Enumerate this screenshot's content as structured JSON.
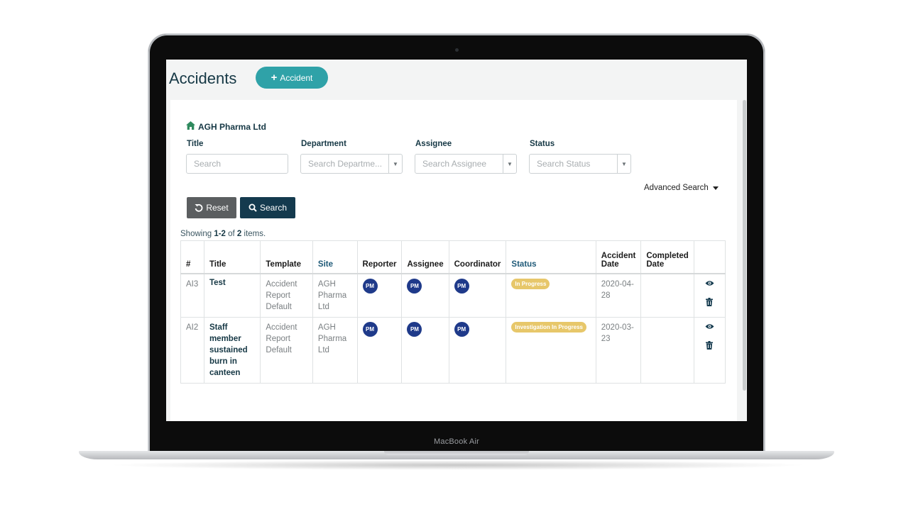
{
  "device": {
    "label": "MacBook Air"
  },
  "page": {
    "title": "Accidents",
    "add_button": "Accident"
  },
  "filters": {
    "company": "AGH Pharma Ltd",
    "title_label": "Title",
    "title_placeholder": "Search",
    "department_label": "Department",
    "department_placeholder": "Search Departme...",
    "assignee_label": "Assignee",
    "assignee_placeholder": "Search Assignee",
    "status_label": "Status",
    "status_placeholder": "Search Status",
    "advanced_search": "Advanced Search",
    "reset": "Reset",
    "search": "Search"
  },
  "summary": {
    "prefix": "Showing ",
    "range": "1-2",
    "of": " of ",
    "total": "2",
    "suffix": " items."
  },
  "table": {
    "headers": {
      "num": "#",
      "title": "Title",
      "template": "Template",
      "site": "Site",
      "reporter": "Reporter",
      "assignee": "Assignee",
      "coordinator": "Coordinator",
      "status": "Status",
      "accident_date": "Accident Date",
      "completed_date": "Completed Date"
    },
    "rows": [
      {
        "id": "AI3",
        "title": "Test",
        "template": "Accident Report Default",
        "site": "AGH Pharma Ltd",
        "reporter": "PM",
        "assignee": "PM",
        "coordinator": "PM",
        "status": "In Progress",
        "accident_date": "2020-04-28",
        "completed_date": ""
      },
      {
        "id": "AI2",
        "title": "Staff member sustained burn in canteen",
        "template": "Accident Report Default",
        "site": "AGH Pharma Ltd",
        "reporter": "PM",
        "assignee": "PM",
        "coordinator": "PM",
        "status": "Investigation In Progress",
        "accident_date": "2020-03-23",
        "completed_date": ""
      }
    ]
  },
  "colors": {
    "accent": "#2fa2a8",
    "primary": "#143a4e",
    "badge": "#e7c76a",
    "avatar": "#1f3a8a"
  }
}
